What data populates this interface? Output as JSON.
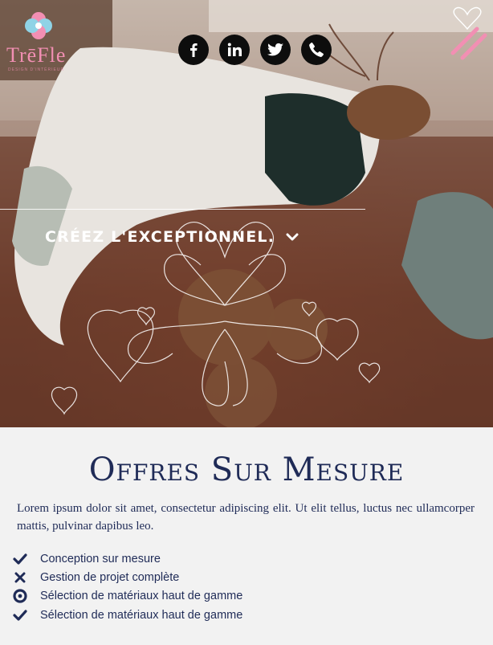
{
  "brand": {
    "name": "TrēFle",
    "tagline": "DESIGN D'INTÉRIEUR"
  },
  "social": [
    {
      "name": "facebook",
      "icon": "facebook-icon"
    },
    {
      "name": "linkedin",
      "icon": "linkedin-icon"
    },
    {
      "name": "twitter",
      "icon": "twitter-icon"
    },
    {
      "name": "phone",
      "icon": "phone-icon"
    }
  ],
  "hero": {
    "tagline": "CRÉEZ L'EXCEPTIONNEL."
  },
  "offers": {
    "title": "Offres Sur Mesure",
    "description": "Lorem ipsum dolor sit amet, consectetur adipiscing elit. Ut elit tellus, luctus nec ullamcorper mattis, pulvinar dapibus leo.",
    "items": [
      {
        "icon": "check-icon",
        "label": "Conception sur mesure"
      },
      {
        "icon": "x-icon",
        "label": "Gestion de projet complète"
      },
      {
        "icon": "dot-circle-icon",
        "label": "Sélection de matériaux haut de gamme"
      },
      {
        "icon": "check-icon",
        "label": "Sélection de matériaux haut de gamme"
      }
    ]
  },
  "colors": {
    "navy": "#1f2b57",
    "pink": "#f28fb3",
    "background": "#f2f2f2"
  }
}
